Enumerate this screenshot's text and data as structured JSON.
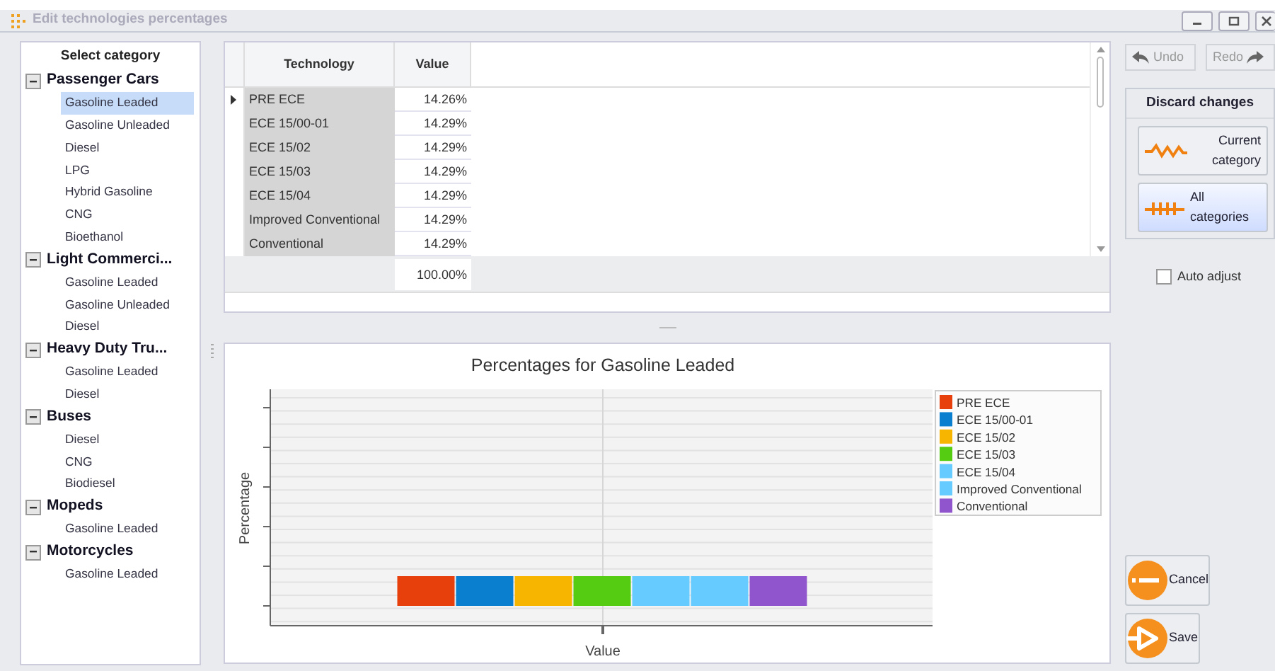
{
  "window": {
    "title": "Edit technologies percentages"
  },
  "category_panel": {
    "title": "Select category",
    "categories": [
      {
        "label": "Passenger Cars",
        "expanded": true,
        "children": [
          {
            "label": "Gasoline Leaded",
            "selected": true
          },
          {
            "label": "Gasoline Unleaded",
            "selected": false
          },
          {
            "label": "Diesel",
            "selected": false
          },
          {
            "label": "LPG",
            "selected": false
          },
          {
            "label": "Hybrid Gasoline",
            "selected": false
          },
          {
            "label": "CNG",
            "selected": false
          },
          {
            "label": "Bioethanol",
            "selected": false
          }
        ]
      },
      {
        "label": "Light Commerci...",
        "expanded": true,
        "children": [
          {
            "label": "Gasoline Leaded",
            "selected": false
          },
          {
            "label": "Gasoline Unleaded",
            "selected": false
          },
          {
            "label": "Diesel",
            "selected": false
          }
        ]
      },
      {
        "label": "Heavy Duty Tru...",
        "expanded": true,
        "children": [
          {
            "label": "Gasoline Leaded",
            "selected": false
          },
          {
            "label": "Diesel",
            "selected": false
          }
        ]
      },
      {
        "label": "Buses",
        "expanded": true,
        "children": [
          {
            "label": "Diesel",
            "selected": false
          },
          {
            "label": "CNG",
            "selected": false
          },
          {
            "label": "Biodiesel",
            "selected": false
          }
        ]
      },
      {
        "label": "Mopeds",
        "expanded": true,
        "children": [
          {
            "label": "Gasoline Leaded",
            "selected": false
          }
        ]
      },
      {
        "label": "Motorcycles",
        "expanded": true,
        "children": [
          {
            "label": "Gasoline Leaded",
            "selected": false
          }
        ]
      }
    ]
  },
  "table": {
    "columns": [
      "Technology",
      "Value"
    ],
    "rows": [
      {
        "technology": "PRE ECE",
        "value": "14.26%",
        "selected": true
      },
      {
        "technology": "ECE 15/00-01",
        "value": "14.29%",
        "selected": false
      },
      {
        "technology": "ECE 15/02",
        "value": "14.29%",
        "selected": false
      },
      {
        "technology": "ECE 15/03",
        "value": "14.29%",
        "selected": false
      },
      {
        "technology": "ECE 15/04",
        "value": "14.29%",
        "selected": false
      },
      {
        "technology": "Improved Conventional",
        "value": "14.29%",
        "selected": false
      },
      {
        "technology": "Conventional",
        "value": "14.29%",
        "selected": false
      }
    ],
    "total": "100.00%"
  },
  "chart": {
    "title": "Percentages for Gasoline Leaded",
    "xlabel": "Value",
    "ylabel": "Percentage",
    "legend": [
      {
        "label": "PRE ECE",
        "color": "#e8400c"
      },
      {
        "label": "ECE 15/00-01",
        "color": "#0a7fcf"
      },
      {
        "label": "ECE 15/02",
        "color": "#f7b500"
      },
      {
        "label": "ECE 15/03",
        "color": "#55cc11"
      },
      {
        "label": "ECE 15/04",
        "color": "#66ccff"
      },
      {
        "label": "Improved Conventional",
        "color": "#66ccff"
      },
      {
        "label": "Conventional",
        "color": "#9055cc"
      }
    ]
  },
  "history": [
    {
      "kind": "undo",
      "label": "Undo",
      "disabled": true
    },
    {
      "kind": "redo",
      "label": "Redo",
      "disabled": true
    }
  ],
  "discard_changes": {
    "title": "Discard changes",
    "buttons": [
      {
        "kind": "current",
        "label": "Current category",
        "highlighted": false
      },
      {
        "kind": "all",
        "label": "All categories",
        "highlighted": true
      }
    ]
  },
  "auto_adjust": {
    "label": "Auto adjust",
    "checked": false
  },
  "actions": [
    {
      "kind": "cancel",
      "label": "Cancel"
    },
    {
      "kind": "save",
      "label": "Save"
    }
  ]
}
